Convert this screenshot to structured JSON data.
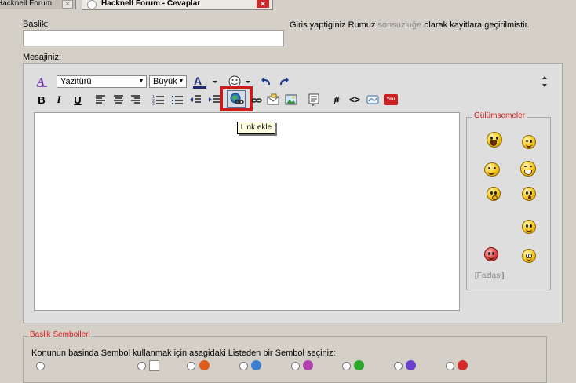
{
  "tabs": [
    {
      "title": "Hacknell Forum",
      "close": "✕"
    },
    {
      "title": "Hacknell Forum - Cevaplar",
      "close": "✕"
    }
  ],
  "form": {
    "title_label": "Baslik:",
    "title_value": "",
    "info_prefix": "Giris yaptiginiz Rumuz ",
    "info_username": "sonsuzluğe",
    "info_suffix": " olarak kayitlara geçirilmistir.",
    "message_label": "Mesajiniz:"
  },
  "toolbar": {
    "font_select": "Yazitürü",
    "size_select": "Büyük",
    "bold": "B",
    "italic": "I",
    "underline": "U",
    "hash": "#",
    "code": "<>",
    "youtube": "You"
  },
  "tooltip": "Link ekle",
  "smilies": {
    "legend": "Gülümsemeler",
    "more_open": "[",
    "more_link": "Fazlasi",
    "more_close": "]"
  },
  "symbols": {
    "legend": "Baslik Sembolleri",
    "instruction": "Konunun basinda Sembol kullanmak için asagidaki Listeden bir Sembol seçiniz:"
  },
  "colors": {
    "highlight": "#c81e1e",
    "legend_red": "#d21a1a"
  }
}
